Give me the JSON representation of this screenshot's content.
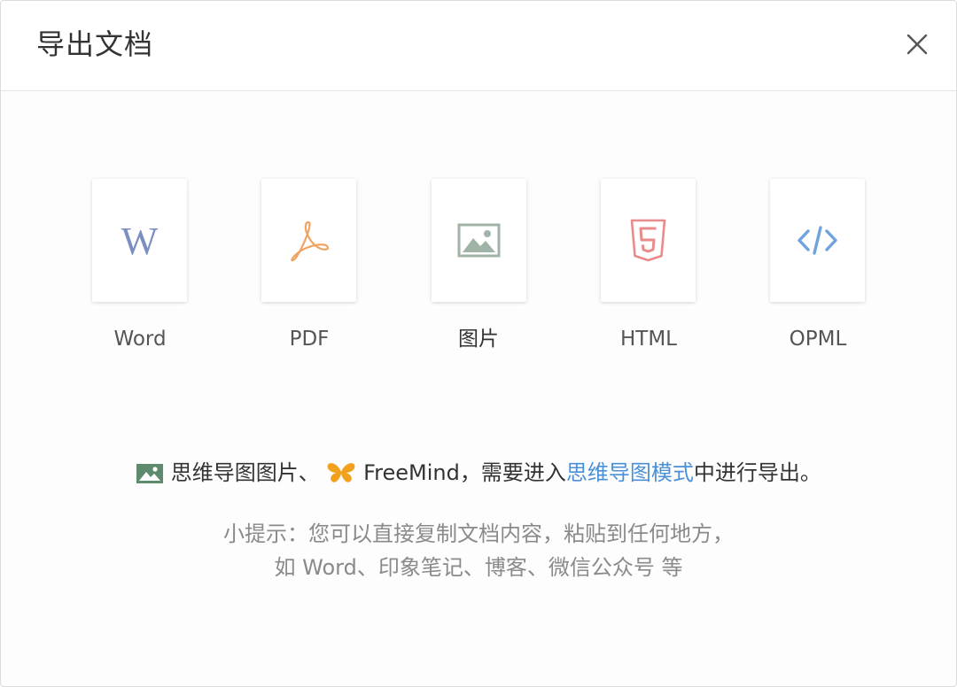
{
  "dialog": {
    "title": "导出文档",
    "close_icon": "close-icon"
  },
  "export_options": [
    {
      "label": "Word",
      "icon": "word-icon",
      "color": "#7b8fc0"
    },
    {
      "label": "PDF",
      "icon": "pdf-icon",
      "color": "#f0a361"
    },
    {
      "label": "图片",
      "icon": "image-icon",
      "color": "#9fb3a6"
    },
    {
      "label": "HTML",
      "icon": "html5-icon",
      "color": "#e98b8b"
    },
    {
      "label": "OPML",
      "icon": "code-icon",
      "color": "#6fa3dc"
    }
  ],
  "mindmap_notice": {
    "part1": "思维导图图片、",
    "part2": "FreeMind，需要进入",
    "link": "思维导图模式",
    "part3": "中进行导出。",
    "image_icon": "image-icon",
    "freemind_icon": "butterfly-icon",
    "link_color": "#4a90d9"
  },
  "tip": {
    "line1": "小提示：您可以直接复制文档内容，粘贴到任何地方，",
    "line2": "如 Word、印象笔记、博客、微信公众号 等"
  }
}
